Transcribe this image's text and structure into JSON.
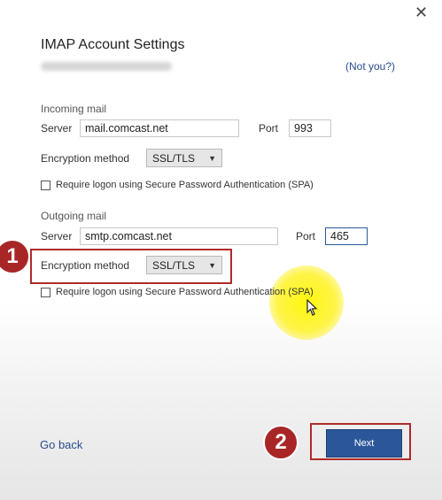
{
  "dialog": {
    "title": "IMAP Account Settings",
    "not_you": "(Not you?)",
    "close_glyph": "✕"
  },
  "incoming": {
    "section": "Incoming mail",
    "server_label": "Server",
    "server_value": "mail.comcast.net",
    "port_label": "Port",
    "port_value": "993",
    "encryption_label": "Encryption method",
    "encryption_value": "SSL/TLS",
    "spa_label": "Require logon using Secure Password Authentication (SPA)"
  },
  "outgoing": {
    "section": "Outgoing mail",
    "server_label": "Server",
    "server_value": "smtp.comcast.net",
    "port_label": "Port",
    "port_value": "465",
    "encryption_label": "Encryption method",
    "encryption_value": "SSL/TLS",
    "spa_label": "Require logon using Secure Password Authentication (SPA)"
  },
  "annotations": {
    "badge_1": "1",
    "badge_2": "2"
  },
  "footer": {
    "go_back": "Go back",
    "next": "Next"
  },
  "colors": {
    "accent": "#2b579a",
    "annotation_red": "#a82626",
    "cursor_highlight": "#fff200"
  }
}
